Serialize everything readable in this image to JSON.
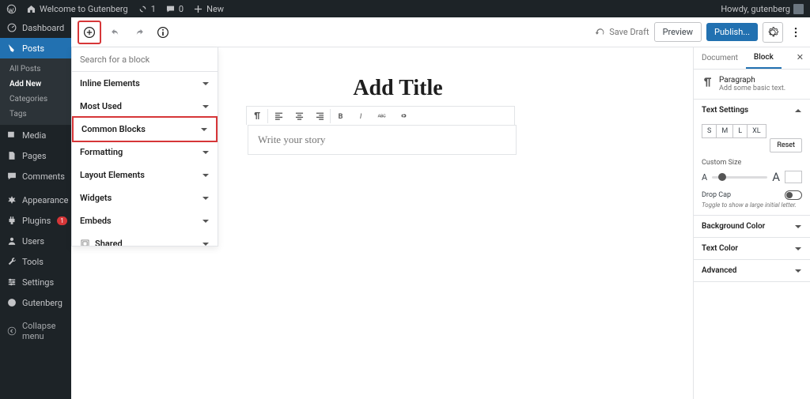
{
  "adminbar": {
    "site": "Welcome to Gutenberg",
    "updates": "1",
    "comments": "0",
    "new": "New",
    "howdy": "Howdy, gutenberg"
  },
  "sidebar": {
    "items": [
      {
        "label": "Dashboard"
      },
      {
        "label": "Posts"
      },
      {
        "label": "Media"
      },
      {
        "label": "Pages"
      },
      {
        "label": "Comments"
      },
      {
        "label": "Appearance"
      },
      {
        "label": "Plugins"
      },
      {
        "label": "Users"
      },
      {
        "label": "Tools"
      },
      {
        "label": "Settings"
      },
      {
        "label": "Gutenberg"
      },
      {
        "label": "Collapse menu"
      }
    ],
    "sub": {
      "all": "All Posts",
      "add": "Add New",
      "cat": "Categories",
      "tags": "Tags"
    },
    "plugins_badge": "1"
  },
  "topbar": {
    "savedraft": "Save Draft",
    "preview": "Preview",
    "publish": "Publish..."
  },
  "inserter": {
    "search_placeholder": "Search for a block",
    "cats": {
      "inline": "Inline Elements",
      "most": "Most Used",
      "common": "Common Blocks",
      "formatting": "Formatting",
      "layout": "Layout Elements",
      "widgets": "Widgets",
      "embeds": "Embeds",
      "shared": "Shared"
    }
  },
  "editor": {
    "title": "Add Title",
    "placeholder": "Write your story"
  },
  "settings": {
    "tabs": {
      "doc": "Document",
      "block": "Block"
    },
    "block_name": "Paragraph",
    "block_desc": "Add some basic text.",
    "text_settings": "Text Settings",
    "sizes": {
      "s": "S",
      "m": "M",
      "l": "L",
      "xl": "XL"
    },
    "reset": "Reset",
    "custom_size": "Custom Size",
    "dropcap": "Drop Cap",
    "dropcap_hint": "Toggle to show a large initial letter.",
    "bg": "Background Color",
    "tc": "Text Color",
    "adv": "Advanced"
  }
}
